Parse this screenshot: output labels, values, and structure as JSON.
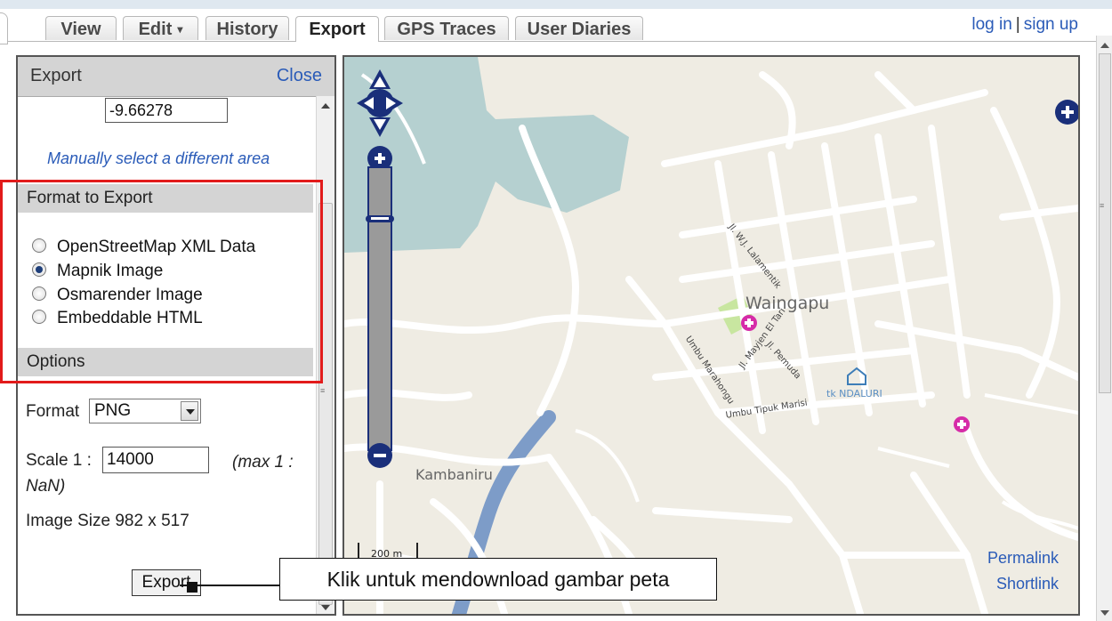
{
  "tabs": [
    {
      "label": "View",
      "active": false
    },
    {
      "label": "Edit",
      "caret": "▾",
      "active": false
    },
    {
      "label": "History",
      "active": false
    },
    {
      "label": "Export",
      "active": true
    },
    {
      "label": "GPS Traces",
      "active": false
    },
    {
      "label": "User Diaries",
      "active": false
    }
  ],
  "user": {
    "login": "log in",
    "separator": "|",
    "signup": "sign up"
  },
  "sidebar": {
    "title": "Export",
    "close": "Close",
    "coord_value": "-9.66278",
    "manual_link": "Manually select a different area",
    "format_header": "Format to Export",
    "formats": [
      {
        "label": "OpenStreetMap XML Data",
        "checked": false
      },
      {
        "label": "Mapnik Image",
        "checked": true
      },
      {
        "label": "Osmarender Image",
        "checked": false
      },
      {
        "label": "Embeddable HTML",
        "checked": false
      }
    ],
    "options_header": "Options",
    "format_label": "Format",
    "format_value": "PNG",
    "scale_label": "Scale 1 :",
    "scale_value": "14000",
    "max_label": "(max 1 :",
    "max_value": "NaN)",
    "image_size": "Image Size 982 x 517",
    "export_button": "Export"
  },
  "map": {
    "labels": {
      "town": "Waingapu",
      "district": "Kambaniru",
      "street1": "Jl. W.J. Lalamentik",
      "street2": "Jl. Mayjen El Tari",
      "street3": "Jl. Pemuda",
      "street4": "Umbu Marahongu",
      "street5": "Umbu Tipuk Marisi",
      "poi": "tk NDALURI",
      "scale": "200 m"
    },
    "permalink": "Permalink",
    "shortlink": "Shortlink",
    "colors": {
      "background": "#efece3",
      "water": "#b5d0d0",
      "river": "#7d9cc8",
      "park": "#c8e6a0",
      "road": "#ffffff",
      "control": "#1a2f7a",
      "poi": "#d62ca8"
    }
  },
  "callout": "Klik untuk mendownload gambar peta",
  "highlight_color": "#e21b1b"
}
